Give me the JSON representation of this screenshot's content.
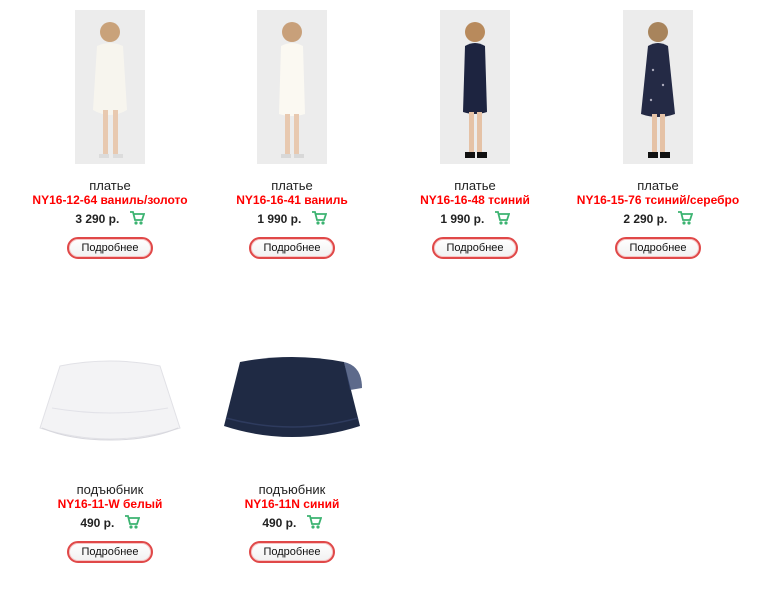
{
  "products": [
    {
      "category": "платье",
      "sku": "NY16-12-64 ваниль/золото",
      "price": "3 290 р.",
      "button": "Подробнее"
    },
    {
      "category": "платье",
      "sku": "NY16-16-41 ваниль",
      "price": "1 990 р.",
      "button": "Подробнее"
    },
    {
      "category": "платье",
      "sku": "NY16-16-48 тсиний",
      "price": "1 990 р.",
      "button": "Подробнее"
    },
    {
      "category": "платье",
      "sku": "NY16-15-76 тсиний/серебро",
      "price": "2 290 р.",
      "button": "Подробнее"
    },
    {
      "category": "подъюбник",
      "sku": "NY16-11-W белый",
      "price": "490 р.",
      "button": "Подробнее"
    },
    {
      "category": "подъюбник",
      "sku": "NY16-11N синий",
      "price": "490 р.",
      "button": "Подробнее"
    }
  ],
  "icons": {
    "cart": "shopping-cart-icon"
  },
  "colors": {
    "sku": "#ff0000",
    "button_border": "#e04848",
    "cart": "#3cb371"
  }
}
